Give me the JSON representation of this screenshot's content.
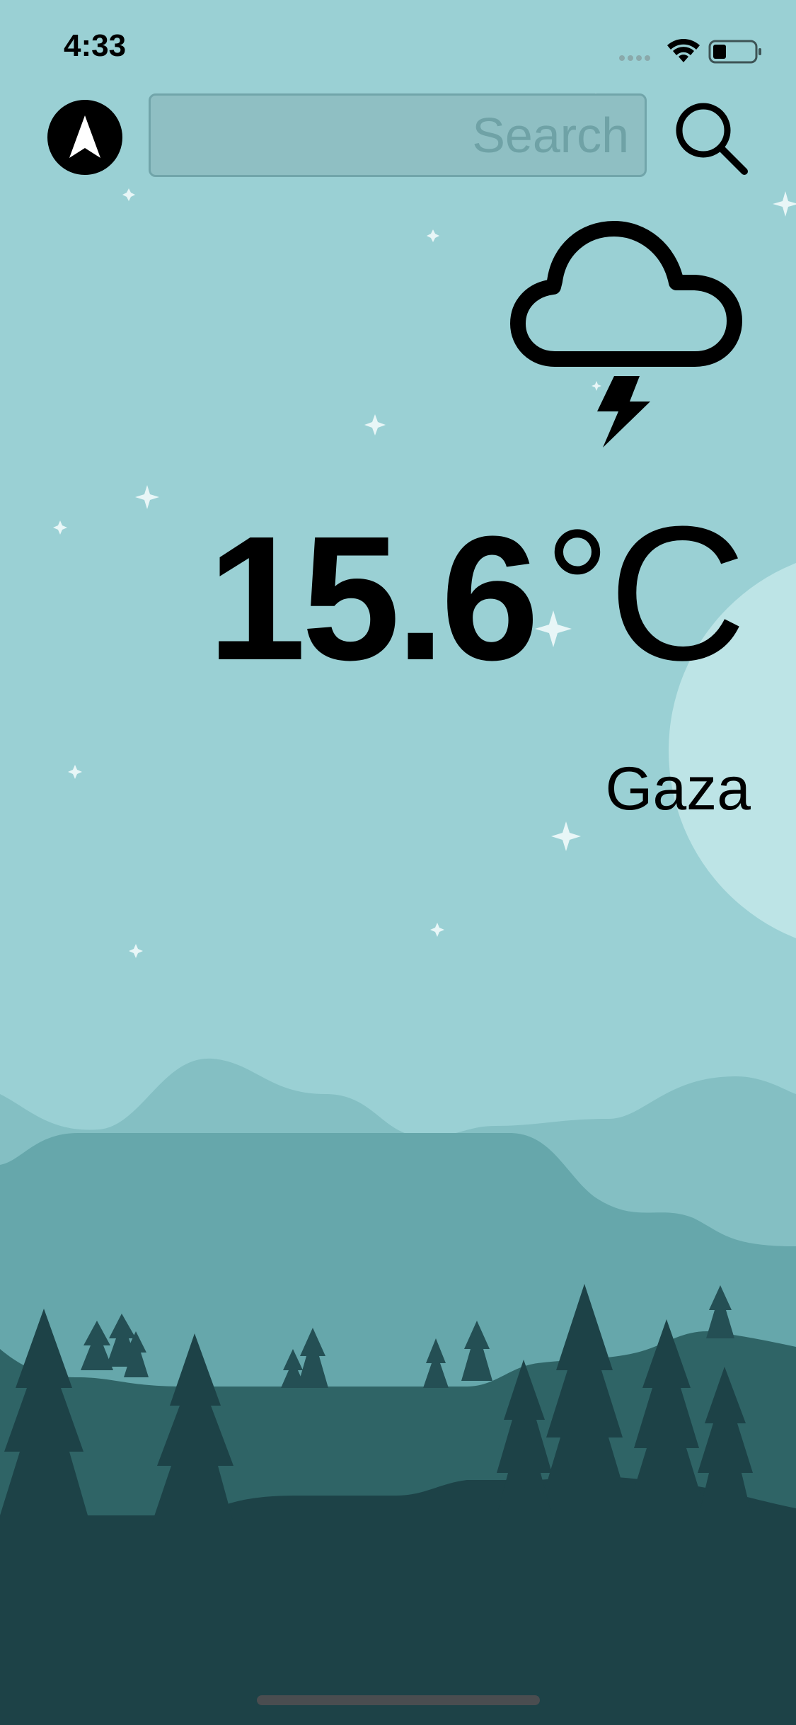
{
  "status_bar": {
    "time": "4:33",
    "icons": [
      "signal-dots-icon",
      "wifi-icon",
      "battery-icon"
    ]
  },
  "toolbar": {
    "location_icon": "navigation-arrow-icon",
    "search_placeholder": "Search",
    "search_value": "",
    "search_icon": "magnifier-icon"
  },
  "weather": {
    "condition_icon": "cloud-lightning-icon",
    "temperature": "15.6",
    "degree_symbol": "°",
    "unit": "C",
    "city": "Gaza"
  },
  "theme": {
    "sky": "#9ad0d4",
    "moon": "#bde4e6",
    "hills_far": "#84bfc3",
    "hills_mid": "#66a7ab",
    "hills_near": "#2f6466",
    "ground": "#1d4247",
    "text": "#000000"
  }
}
